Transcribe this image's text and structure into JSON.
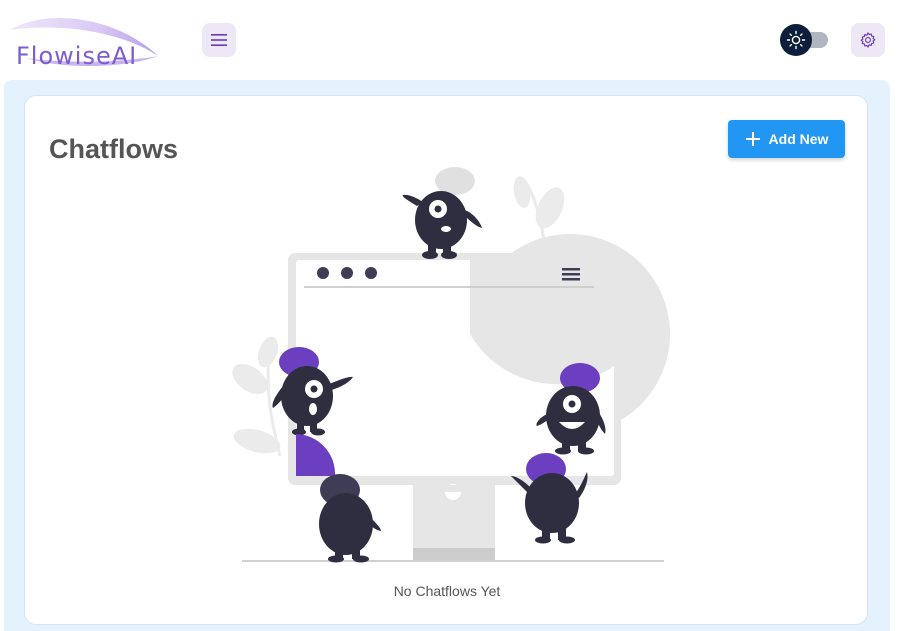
{
  "header": {
    "logo_text": "FlowiseAI",
    "menu_icon": "hamburger-menu-icon",
    "theme_icon": "sun-icon",
    "settings_icon": "gear-icon"
  },
  "main": {
    "title": "Chatflows",
    "add_button_label": "Add New",
    "add_button_icon": "plus-icon",
    "empty_message": "No Chatflows Yet"
  },
  "colors": {
    "accent_purple": "#673ab7",
    "primary_blue": "#2196f3",
    "icon_button_bg": "#ede7f6",
    "background_blue": "#e3f2fd",
    "creature_dark": "#2f2e41"
  }
}
